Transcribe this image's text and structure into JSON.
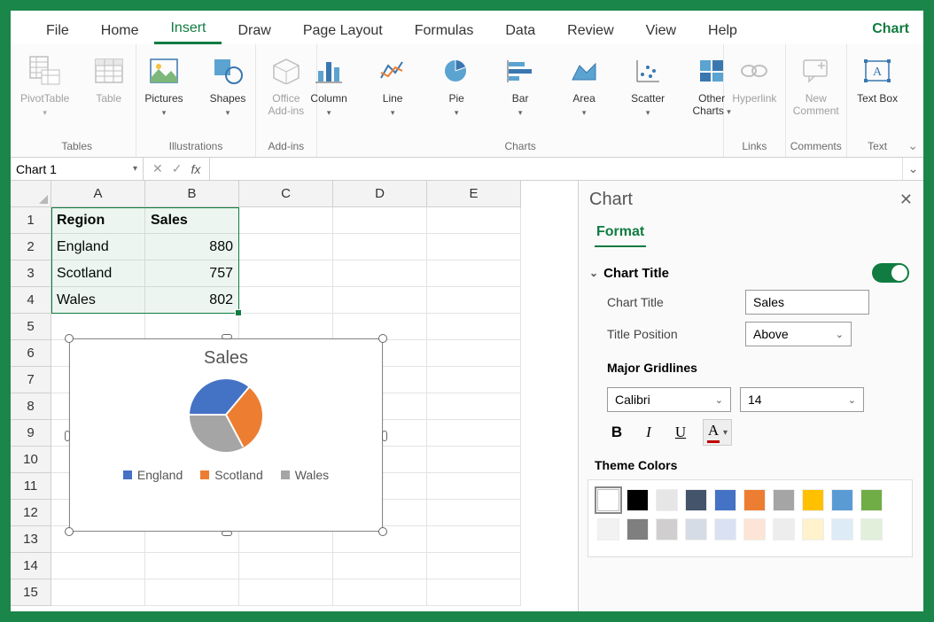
{
  "tabs": {
    "items": [
      "File",
      "Home",
      "Insert",
      "Draw",
      "Page Layout",
      "Formulas",
      "Data",
      "Review",
      "View",
      "Help"
    ],
    "active": "Insert",
    "context_tab": "Chart"
  },
  "ribbon": {
    "groups": [
      {
        "label": "Tables",
        "buttons": [
          {
            "name": "pivottable",
            "label": "PivotTable",
            "disabled": true,
            "dropdown": true
          },
          {
            "name": "table",
            "label": "Table",
            "disabled": true
          }
        ]
      },
      {
        "label": "Illustrations",
        "buttons": [
          {
            "name": "pictures",
            "label": "Pictures",
            "dropdown": true
          },
          {
            "name": "shapes",
            "label": "Shapes",
            "dropdown": true
          }
        ]
      },
      {
        "label": "Add-ins",
        "buttons": [
          {
            "name": "office-addins",
            "label": "Office Add-ins",
            "disabled": true
          }
        ]
      },
      {
        "label": "Charts",
        "buttons": [
          {
            "name": "column",
            "label": "Column",
            "dropdown": true
          },
          {
            "name": "line",
            "label": "Line",
            "dropdown": true
          },
          {
            "name": "pie",
            "label": "Pie",
            "dropdown": true
          },
          {
            "name": "bar",
            "label": "Bar",
            "dropdown": true
          },
          {
            "name": "area",
            "label": "Area",
            "dropdown": true
          },
          {
            "name": "scatter",
            "label": "Scatter",
            "dropdown": true
          },
          {
            "name": "other-charts",
            "label": "Other Charts",
            "dropdown": true
          }
        ]
      },
      {
        "label": "Links",
        "buttons": [
          {
            "name": "hyperlink",
            "label": "Hyperlink",
            "disabled": true
          }
        ]
      },
      {
        "label": "Comments",
        "buttons": [
          {
            "name": "new-comment",
            "label": "New Comment",
            "disabled": true
          }
        ]
      },
      {
        "label": "Text",
        "buttons": [
          {
            "name": "text-box",
            "label": "Text Box"
          }
        ]
      }
    ]
  },
  "name_box": "Chart 1",
  "columns": [
    "A",
    "B",
    "C",
    "D",
    "E"
  ],
  "row_count": 15,
  "sheet": {
    "A1": "Region",
    "B1": "Sales",
    "A2": "England",
    "B2": "880",
    "A3": "Scotland",
    "B3": "757",
    "A4": "Wales",
    "B4": "802"
  },
  "chart_data": {
    "type": "pie",
    "title": "Sales",
    "categories": [
      "England",
      "Scotland",
      "Wales"
    ],
    "values": [
      880,
      757,
      802
    ],
    "colors": [
      "#4472c4",
      "#ed7d31",
      "#a5a5a5"
    ],
    "legend_position": "bottom"
  },
  "panel": {
    "title": "Chart",
    "tab": "Format",
    "section": "Chart Title",
    "chart_title_label": "Chart Title",
    "chart_title_value": "Sales",
    "title_position_label": "Title Position",
    "title_position_value": "Above",
    "gridlines_label": "Major Gridlines",
    "font_name": "Calibri",
    "font_size": "14",
    "palette_label": "Theme Colors",
    "palette": {
      "row1": [
        "#ffffff",
        "#000000",
        "#e7e6e6",
        "#44546a",
        "#4472c4",
        "#ed7d31",
        "#a5a5a5",
        "#ffc000",
        "#5b9bd5",
        "#70ad47"
      ],
      "row2": [
        "#f2f2f2",
        "#7f7f7f",
        "#d0cece",
        "#d6dce5",
        "#d9e1f2",
        "#fce4d6",
        "#ededed",
        "#fff2cc",
        "#ddebf7",
        "#e2efda"
      ]
    },
    "selected_color_index": 0
  }
}
